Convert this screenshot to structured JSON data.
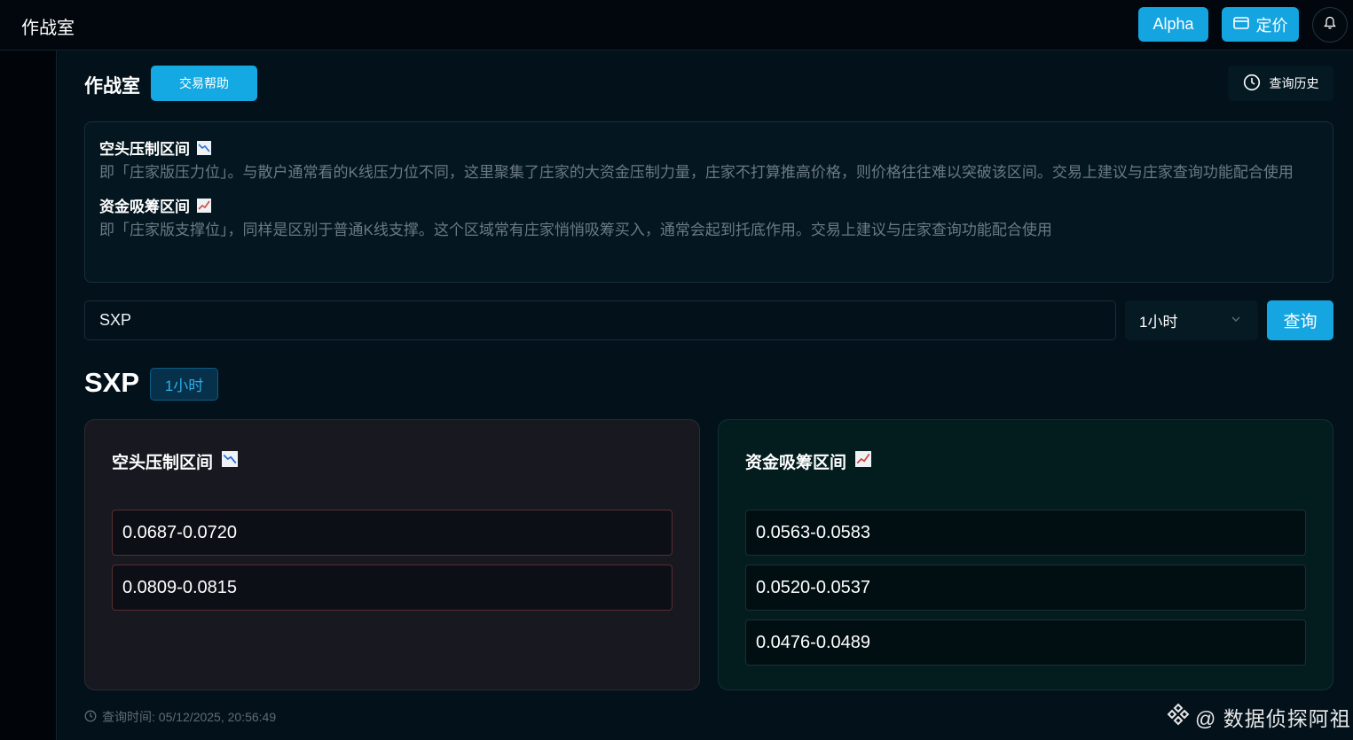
{
  "header": {
    "title": "作战室",
    "alpha_label": "Alpha",
    "pricing_label": "定价"
  },
  "page": {
    "title": "作战室",
    "help_label": "交易帮助",
    "history_label": "查询历史"
  },
  "info": {
    "short_title": "空头压制区间",
    "short_desc": "即「庄家版压力位」。与散户通常看的K线压力位不同，这里聚集了庄家的大资金压制力量，庄家不打算推高价格，则价格往往难以突破该区间。交易上建议与庄家查询功能配合使用",
    "long_title": "资金吸筹区间",
    "long_desc": "即「庄家版支撑位」，同样是区别于普通K线支撑。这个区域常有庄家悄悄吸筹买入，通常会起到托底作用。交易上建议与庄家查询功能配合使用"
  },
  "search": {
    "symbol_value": "SXP",
    "interval_value": "1小时",
    "query_label": "查询"
  },
  "result": {
    "symbol": "SXP",
    "interval_badge": "1小时",
    "short_panel": {
      "title": "空头压制区间",
      "ranges": [
        "0.0687-0.0720",
        "0.0809-0.0815"
      ]
    },
    "long_panel": {
      "title": "资金吸筹区间",
      "ranges": [
        "0.0563-0.0583",
        "0.0520-0.0537",
        "0.0476-0.0489"
      ]
    },
    "query_time": "查询时间: 05/12/2025, 20:56:49"
  },
  "watermark": "@ 数据侦探阿祖",
  "colors": {
    "accent": "#14a4e0",
    "short_border": "#5a2e2e",
    "long_bg": "#031d1f"
  },
  "icons": [
    "card-icon",
    "bell-icon",
    "clock-icon",
    "chart-down-icon",
    "chart-up-icon",
    "chevron-down-icon",
    "binance-logo-icon"
  ]
}
